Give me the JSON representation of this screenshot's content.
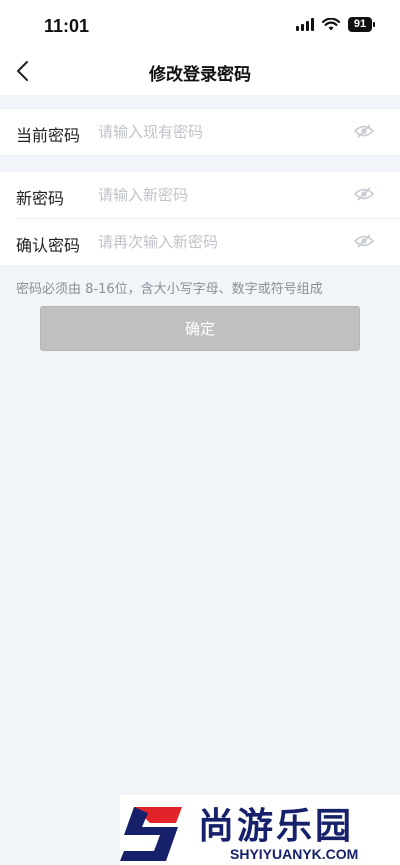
{
  "status_bar": {
    "time": "11:01",
    "battery": "91",
    "icons": [
      "signal-icon",
      "wifi-icon",
      "battery-icon"
    ]
  },
  "nav": {
    "title": "修改登录密码",
    "back_icon": "chevron-left-icon"
  },
  "form": {
    "current_password": {
      "label": "当前密码",
      "placeholder": "请输入现有密码",
      "value": ""
    },
    "new_password": {
      "label": "新密码",
      "placeholder": "请输入新密码",
      "value": ""
    },
    "confirm_password": {
      "label": "确认密码",
      "placeholder": "请再次输入新密码",
      "value": ""
    },
    "visibility_icon": "eye-hidden-icon"
  },
  "hint": "密码必须由 8-16位，含大小写字母、数字或符号组成",
  "confirm_button": {
    "label": "确定"
  },
  "watermark": {
    "title": "尚游乐园",
    "url": "SHYIYUANYK.COM",
    "logo": "s-logo-icon"
  },
  "colors": {
    "background": "#f1f4f8",
    "button_disabled": "#c0c0c0",
    "placeholder": "#bfc3c9",
    "watermark_navy": "#16206b",
    "watermark_red": "#e0242a"
  }
}
